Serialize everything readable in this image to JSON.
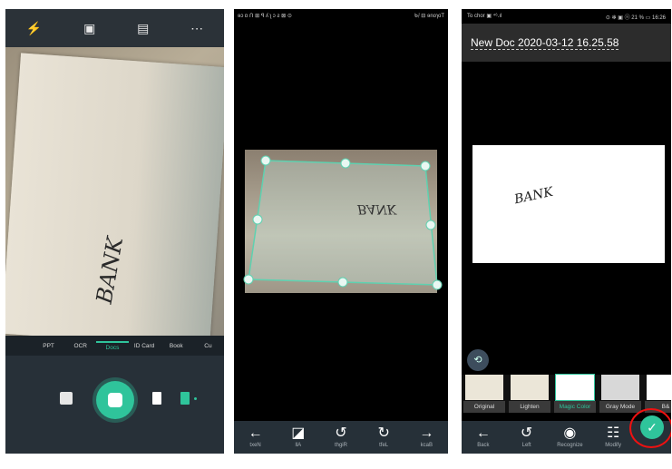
{
  "screen1": {
    "toolbar": {
      "flash": "⚡",
      "shape": "▣",
      "doc": "▤",
      "more": "⋯"
    },
    "document_text": "BANK",
    "modes": [
      "PPT",
      "OCR",
      "Docs",
      "ID Card",
      "Book",
      "Cu"
    ],
    "active_mode": "Docs",
    "nav": [
      "◁",
      "○",
      "□"
    ]
  },
  "screen2": {
    "status_left": "ɘɔ ɒ ᑎ ⊞ ꟼ ʎ ʅ ɔ ꙅ ⊠ ⊙",
    "status_right": "ᑲᵢˡ ⊟ ɘnoɿoT",
    "document_text": "BANK",
    "toolbar": [
      {
        "icon": "←",
        "label": "txeN"
      },
      {
        "icon": "◪",
        "label": "llA"
      },
      {
        "icon": "↺",
        "label": "thgiR"
      },
      {
        "icon": "↻",
        "label": "tfeL"
      },
      {
        "icon": "→",
        "label": "kcaB"
      }
    ],
    "nav": [
      "□",
      "○",
      "▷"
    ]
  },
  "screen3": {
    "status_left": "To chor ▣ ⁴⁶.ıl",
    "status_right": "⊙ ✻ ▣ ⓝ 21 % ▭ 16:26",
    "title": "New Doc 2020-03-12 16.25.58",
    "document_text": "BANK",
    "rotate_icon": "⟲",
    "filters": [
      {
        "label": "Original"
      },
      {
        "label": "Lighten"
      },
      {
        "label": "Magic Color"
      },
      {
        "label": "Gray Mode"
      },
      {
        "label": "B&"
      }
    ],
    "selected_filter": "Magic Color",
    "toolbar": [
      {
        "icon": "←",
        "label": "Back"
      },
      {
        "icon": "↺",
        "label": "Left"
      },
      {
        "icon": "◉",
        "label": "Recognize"
      },
      {
        "icon": "☷",
        "label": "Modify"
      }
    ],
    "confirm_icon": "✓",
    "nav": [
      "◁",
      "○",
      "□"
    ]
  }
}
